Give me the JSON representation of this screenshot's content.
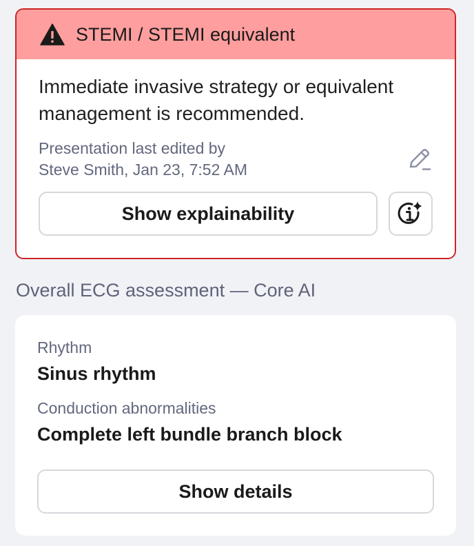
{
  "alert": {
    "title": "STEMI / STEMI equivalent",
    "icon": "warning-triangle-icon",
    "message": "Immediate invasive strategy or equivalent management is recommended.",
    "edit_line1": "Presentation last edited by",
    "edit_line2": "Steve Smith, Jan 23, 7:52 AM",
    "edit_icon": "pencil-icon",
    "explain_label": "Show explainability",
    "ai_info_icon": "ai-info-icon",
    "colors": {
      "border": "#cc2525",
      "header_bg": "#ff9e9e"
    }
  },
  "assessment": {
    "heading": "Overall ECG assessment — Core AI",
    "rhythm_label": "Rhythm",
    "rhythm_value": "Sinus rhythm",
    "conduction_label": "Conduction abnormalities",
    "conduction_value": "Complete left bundle branch block",
    "details_label": "Show details"
  }
}
